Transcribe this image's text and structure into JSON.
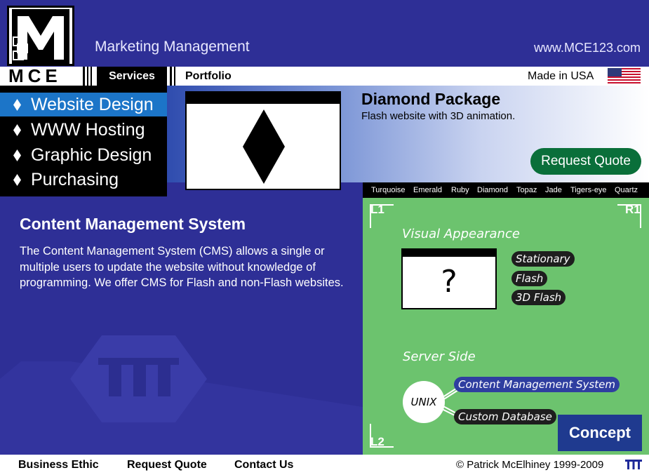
{
  "header": {
    "logo_text": "MCE",
    "tagline": "Marketing Management",
    "url": "www.MCE123.com"
  },
  "nav": {
    "services_label": "Services",
    "portfolio_label": "Portfolio",
    "made_in": "Made in USA"
  },
  "menu": {
    "items": [
      {
        "label": "Website Design"
      },
      {
        "label": "WWW Hosting"
      },
      {
        "label": "Graphic Design"
      },
      {
        "label": "Purchasing"
      }
    ]
  },
  "package": {
    "title": "Diamond Package",
    "subtitle": "Flash website with 3D animation.",
    "request_label": "Request Quote"
  },
  "gems": [
    "Turquoise",
    "Emerald",
    "Ruby",
    "Diamond",
    "Topaz",
    "Jade",
    "Tigers-eye",
    "Quartz"
  ],
  "cms": {
    "title": "Content Management System",
    "body": "The Content Management System (CMS) allows a single or multiple users to update the website without knowledge of programming. We offer CMS for Flash and non-Flash websites."
  },
  "concept": {
    "corner_l1": "L1",
    "corner_r1": "R1",
    "corner_l2": "L2",
    "visual_title": "Visual Appearance",
    "question_mark": "?",
    "options": [
      "Stationary",
      "Flash",
      "3D Flash"
    ],
    "server_title": "Server Side",
    "unix_label": "UNIX",
    "cms_pill": "Content Management System",
    "db_pill": "Custom Database",
    "button_label": "Concept"
  },
  "footer": {
    "links": [
      "Business Ethic",
      "Request Quote",
      "Contact Us"
    ],
    "copyright": "© Patrick McElhiney 1999-2009"
  },
  "colors": {
    "brand_blue": "#2e2f96",
    "concept_green": "#6cc36e",
    "active_menu": "#1c75c8",
    "button_green": "#0a6f3a"
  }
}
